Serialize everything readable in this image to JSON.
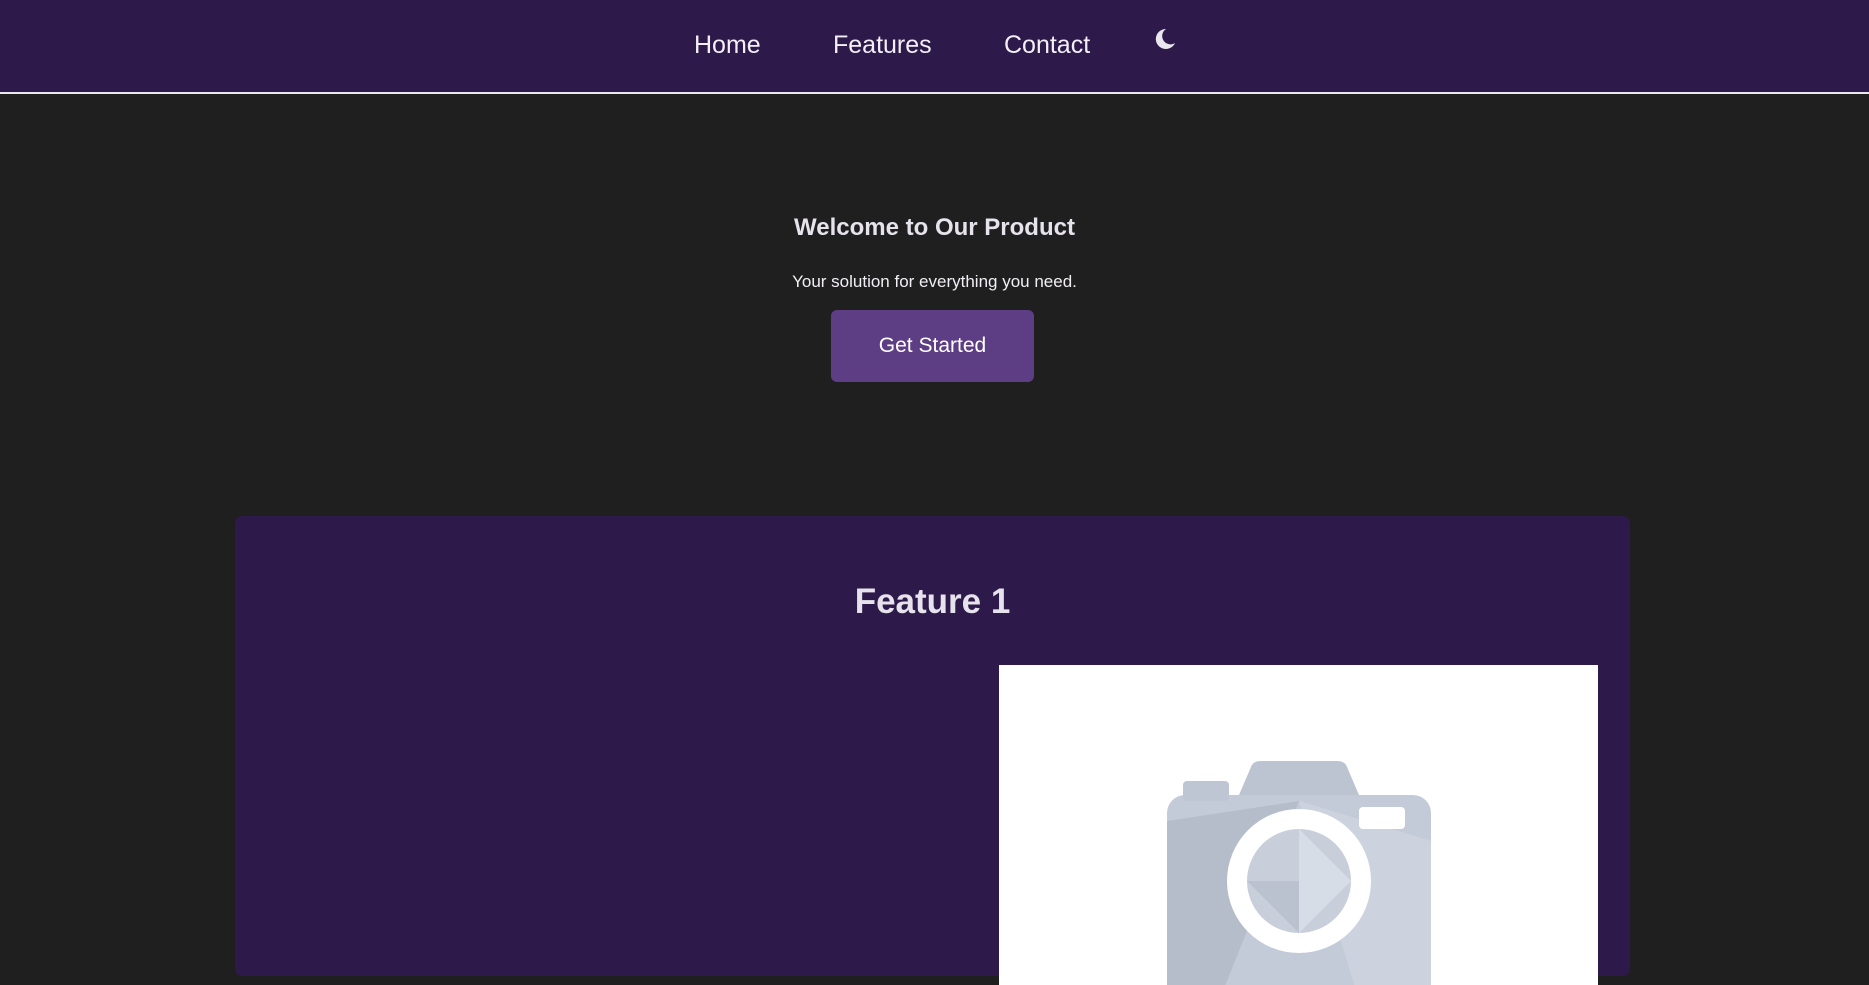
{
  "nav": {
    "links": [
      {
        "label": "Home"
      },
      {
        "label": "Features"
      },
      {
        "label": "Contact"
      }
    ],
    "theme_toggle_icon": "moon-icon"
  },
  "hero": {
    "title": "Welcome to Our Product",
    "subtitle": "Your solution for everything you need.",
    "cta_label": "Get Started"
  },
  "features": [
    {
      "title": "Feature 1",
      "image_icon": "camera-placeholder-icon"
    }
  ],
  "colors": {
    "nav_bg": "#2e1a4a",
    "page_bg": "#1f1f1f",
    "accent": "#5d3e85",
    "card_bg": "#2e1a4a",
    "text": "#e7e3ec"
  }
}
